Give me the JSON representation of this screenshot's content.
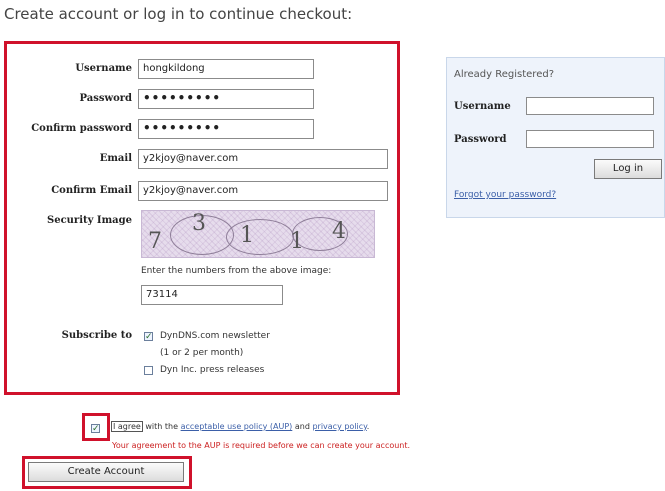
{
  "heading": "Create account or log in to continue checkout:",
  "registration": {
    "username": {
      "label": "Username",
      "value": "hongkildong"
    },
    "password": {
      "label": "Password",
      "value": "•••••••••"
    },
    "confirm_password": {
      "label": "Confirm password",
      "value": "•••••••••"
    },
    "email": {
      "label": "Email",
      "value": "y2kjoy@naver.com"
    },
    "confirm_email": {
      "label": "Confirm Email",
      "value": "y2kjoy@naver.com"
    },
    "security_image": {
      "label": "Security Image",
      "digits": [
        "7",
        "3",
        "1",
        "1",
        "4"
      ],
      "instruction": "Enter the numbers from the above image:",
      "answer": "73114"
    },
    "subscribe": {
      "label": "Subscribe to",
      "newsletter_label": "DynDNS.com newsletter",
      "newsletter_note": "(1 or 2 per month)",
      "newsletter_checked": true,
      "press_label": "Dyn Inc. press releases",
      "press_checked": false
    }
  },
  "login": {
    "title": "Already Registered?",
    "username_label": "Username",
    "username_value": "",
    "password_label": "Password",
    "password_value": "",
    "button": "Log in",
    "forgot": "Forgot your password?"
  },
  "agreement": {
    "checked": true,
    "agree_word": "I agree",
    "with_text": "with the",
    "aup_link": "acceptable use policy (AUP)",
    "and_text": "and",
    "privacy_link": "privacy policy",
    "period": ".",
    "error": "Your agreement to the AUP is required before we can create your account."
  },
  "create_button": "Create Account",
  "colors": {
    "highlight_red": "#d0112b",
    "link_blue": "#3b5fa8",
    "error_red": "#cc2222"
  }
}
